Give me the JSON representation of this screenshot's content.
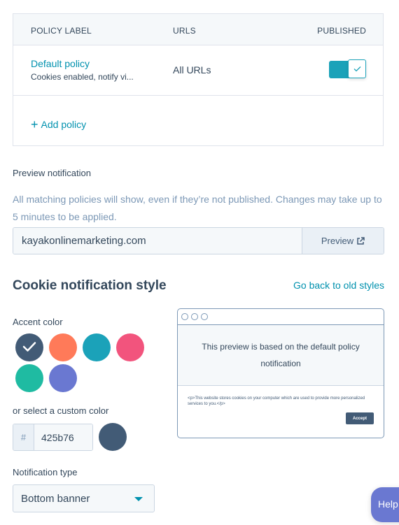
{
  "policy_table": {
    "headers": {
      "label": "POLICY LABEL",
      "urls": "URLS",
      "published": "PUBLISHED"
    },
    "rows": [
      {
        "name": "Default policy",
        "description": "Cookies enabled, notify vi...",
        "urls": "All URLs",
        "published": true
      }
    ],
    "add_policy_label": "Add policy"
  },
  "preview": {
    "title": "Preview notification",
    "help_text": "All matching policies will show, even if they’re not published. Changes may take up to 5 minutes to be applied.",
    "url_value": "kayakonlinemarketing.com",
    "button_label": "Preview"
  },
  "style": {
    "heading": "Cookie notification style",
    "old_styles_link": "Go back to old styles",
    "accent_label": "Accent color",
    "accent_colors": [
      {
        "name": "slate",
        "hex": "#425b76",
        "selected": true
      },
      {
        "name": "orange",
        "hex": "#ff7a59",
        "selected": false
      },
      {
        "name": "teal",
        "hex": "#1ba2b9",
        "selected": false
      },
      {
        "name": "pink",
        "hex": "#f2547d",
        "selected": false
      },
      {
        "name": "green",
        "hex": "#1fbba2",
        "selected": false
      },
      {
        "name": "purple",
        "hex": "#6a78d1",
        "selected": false
      }
    ],
    "custom_label": "or select a custom color",
    "hex_prefix": "#",
    "custom_hex": "425b76",
    "custom_color": "#425b76",
    "type_label": "Notification type",
    "type_value": "Bottom banner"
  },
  "mock_preview": {
    "message": "This preview is based on the default policy notification",
    "banner_text": "<p>This website stores cookies on your computer which are used to provide more personalized services to you.</p>",
    "accept_label": "Accept"
  },
  "help_button": "Help",
  "colors": {
    "link": "#0091ae",
    "accent": "#1ba2b9",
    "text": "#33475b"
  }
}
